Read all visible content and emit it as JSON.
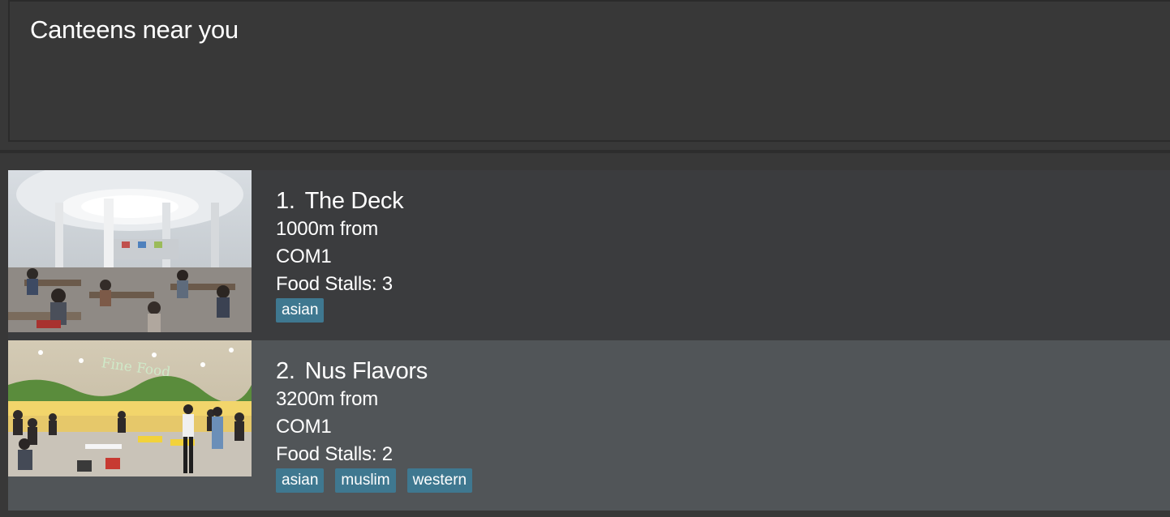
{
  "header": {
    "title": "Canteens near you"
  },
  "canteens": [
    {
      "index": "1.",
      "name": "The Deck",
      "distance": "1000m from",
      "reference": "COM1",
      "stalls_label": "Food Stalls:",
      "stalls_count": "3",
      "tags": [
        "asian"
      ]
    },
    {
      "index": "2.",
      "name": "Nus Flavors",
      "distance": "3200m from",
      "reference": "COM1",
      "stalls_label": "Food Stalls:",
      "stalls_count": "2",
      "tags": [
        "asian",
        "muslim",
        "western"
      ],
      "photo_sign": "Fine Food"
    }
  ],
  "colors": {
    "background": "#383838",
    "card_odd": "#3b3c3e",
    "card_even": "#515558",
    "tag": "#3f7890",
    "text": "#ffffff"
  }
}
